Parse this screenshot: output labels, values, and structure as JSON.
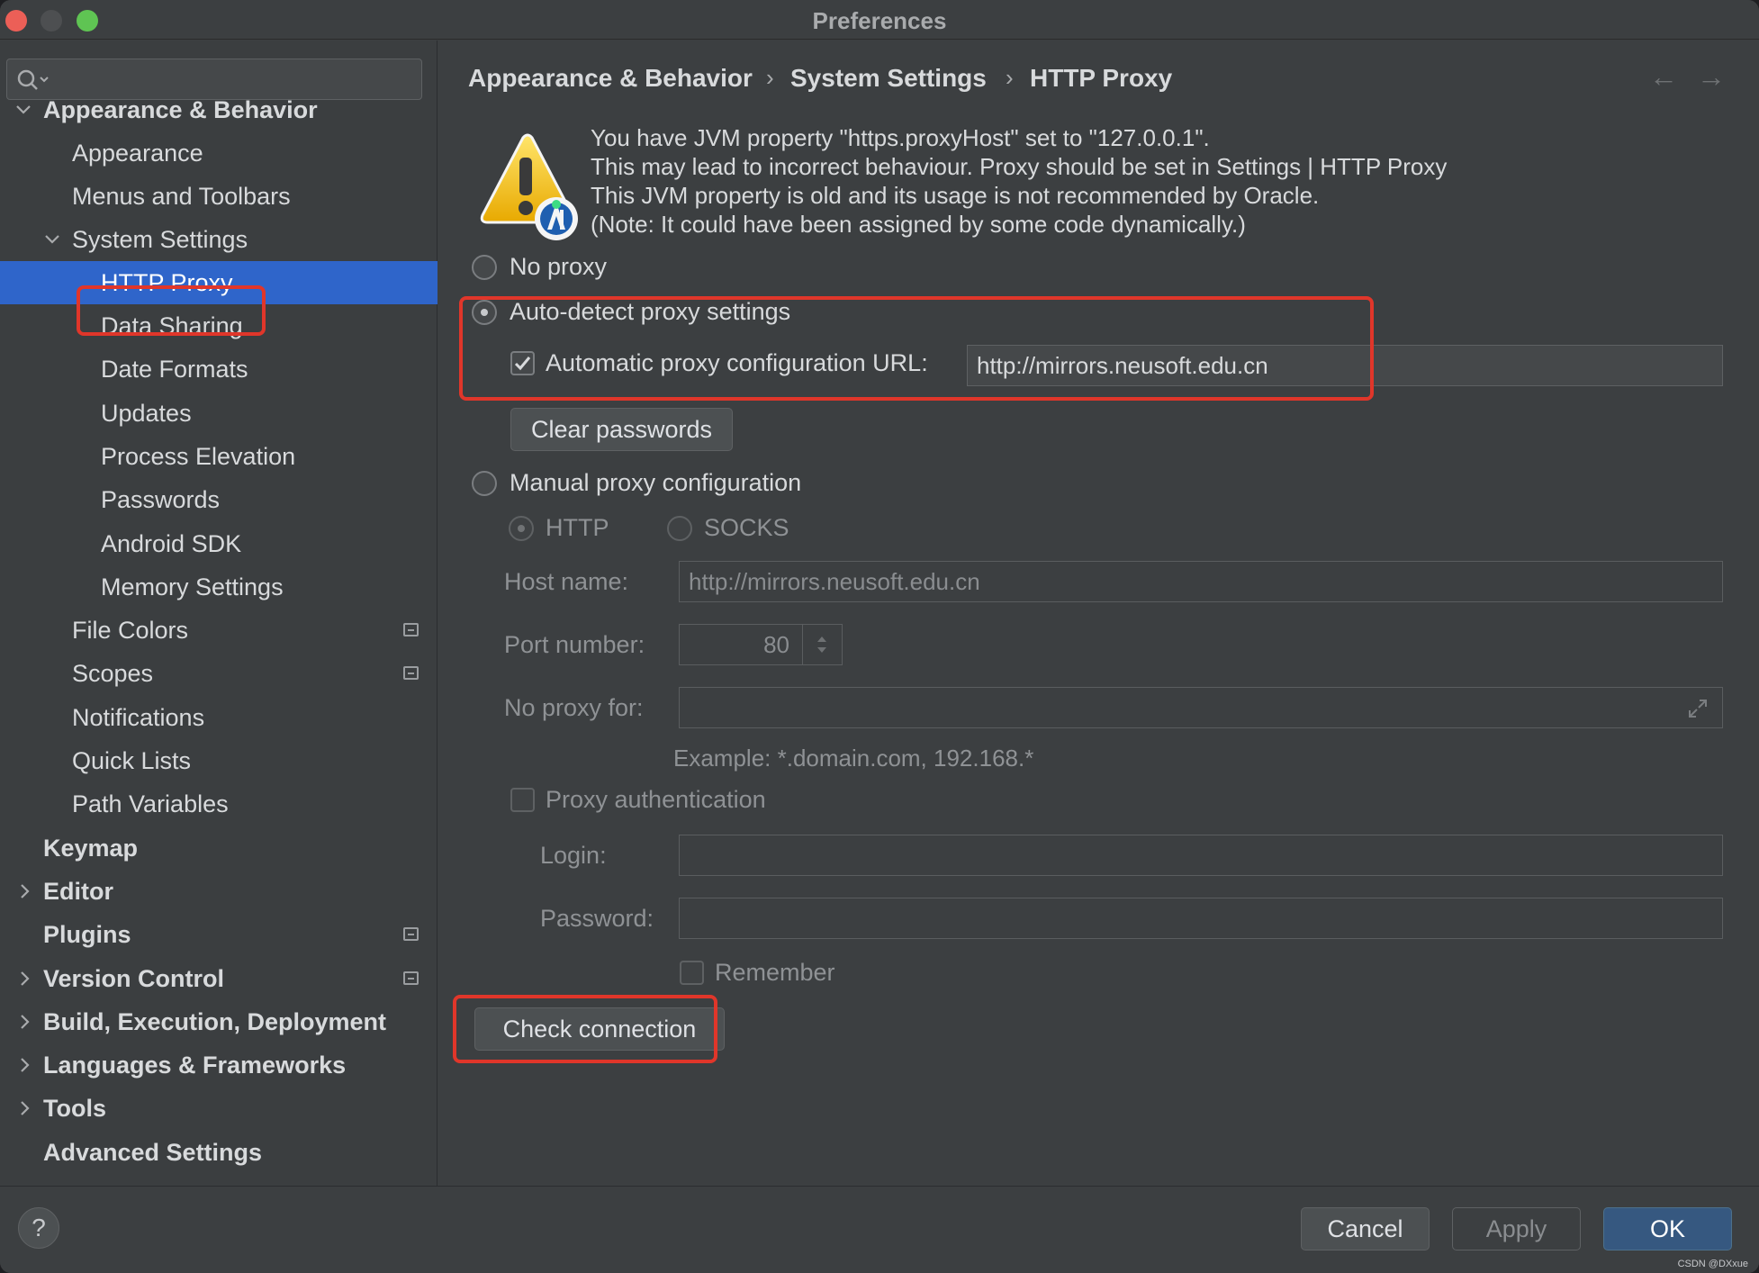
{
  "window": {
    "title": "Preferences"
  },
  "sidebar": {
    "search_placeholder": "",
    "items": [
      {
        "label": "Appearance & Behavior"
      },
      {
        "label": "Appearance"
      },
      {
        "label": "Menus and Toolbars"
      },
      {
        "label": "System Settings"
      },
      {
        "label": "HTTP Proxy"
      },
      {
        "label": "Data Sharing"
      },
      {
        "label": "Date Formats"
      },
      {
        "label": "Updates"
      },
      {
        "label": "Process Elevation"
      },
      {
        "label": "Passwords"
      },
      {
        "label": "Android SDK"
      },
      {
        "label": "Memory Settings"
      },
      {
        "label": "File Colors"
      },
      {
        "label": "Scopes"
      },
      {
        "label": "Notifications"
      },
      {
        "label": "Quick Lists"
      },
      {
        "label": "Path Variables"
      },
      {
        "label": "Keymap"
      },
      {
        "label": "Editor"
      },
      {
        "label": "Plugins"
      },
      {
        "label": "Version Control"
      },
      {
        "label": "Build, Execution, Deployment"
      },
      {
        "label": "Languages & Frameworks"
      },
      {
        "label": "Tools"
      },
      {
        "label": "Advanced Settings"
      }
    ]
  },
  "breadcrumb": {
    "items": [
      "Appearance & Behavior",
      "System Settings",
      "HTTP Proxy"
    ],
    "separator": "›"
  },
  "warning": {
    "lines": [
      "You have JVM property \"https.proxyHost\" set to \"127.0.0.1\".",
      "This may lead to incorrect behaviour. Proxy should be set in Settings | HTTP Proxy",
      "This JVM property is old and its usage is not recommended by Oracle.",
      "(Note: It could have been assigned by some code dynamically.)"
    ]
  },
  "proxy": {
    "no_proxy_label": "No proxy",
    "auto_detect_label": "Auto-detect proxy settings",
    "auto_url_label": "Automatic proxy configuration URL:",
    "auto_url_value": "http://mirrors.neusoft.edu.cn",
    "clear_passwords_label": "Clear passwords",
    "manual_label": "Manual proxy configuration",
    "http_label": "HTTP",
    "socks_label": "SOCKS",
    "host_label": "Host name:",
    "host_value": "http://mirrors.neusoft.edu.cn",
    "port_label": "Port number:",
    "port_value": "80",
    "no_proxy_for_label": "No proxy for:",
    "no_proxy_for_value": "",
    "example_text": "Example: *.domain.com, 192.168.*",
    "auth_label": "Proxy authentication",
    "login_label": "Login:",
    "login_value": "",
    "password_label": "Password:",
    "password_value": "",
    "remember_label": "Remember",
    "check_connection_label": "Check connection"
  },
  "footer": {
    "help_label": "?",
    "cancel_label": "Cancel",
    "apply_label": "Apply",
    "ok_label": "OK",
    "watermark": "CSDN @DXxue"
  },
  "colors": {
    "selection": "#2f65ca",
    "highlight_box": "#e0362a",
    "primary_button": "#365880"
  }
}
